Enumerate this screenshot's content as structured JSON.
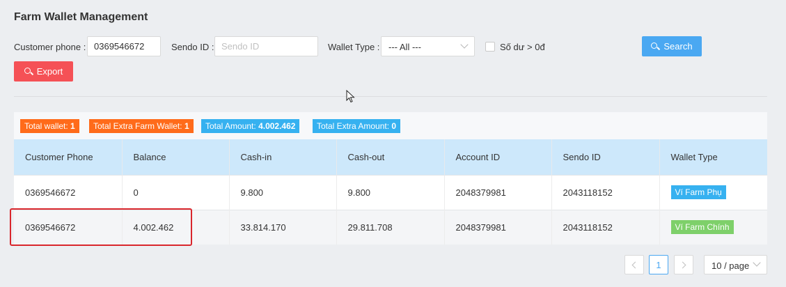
{
  "page": {
    "title": "Farm Wallet Management"
  },
  "filters": {
    "customer_phone_label": "Customer phone :",
    "customer_phone_value": "0369546672",
    "sendo_id_label": "Sendo ID :",
    "sendo_id_placeholder": "Sendo ID",
    "wallet_type_label": "Wallet Type :",
    "wallet_type_value": "--- All ---",
    "balance_checkbox_label": "Số dư > 0đ",
    "balance_checkbox_checked": false,
    "search_label": "Search",
    "export_label": "Export"
  },
  "summary": {
    "total_wallet_label": "Total wallet:",
    "total_wallet_value": "1",
    "total_extra_label": "Total Extra Farm Wallet:",
    "total_extra_value": "1",
    "total_amount_label": "Total Amount:",
    "total_amount_value": "4.002.462",
    "total_extra_amount_label": "Total Extra Amount:",
    "total_extra_amount_value": "0"
  },
  "table": {
    "columns": [
      "Customer Phone",
      "Balance",
      "Cash-in",
      "Cash-out",
      "Account ID",
      "Sendo ID",
      "Wallet Type"
    ],
    "rows": [
      {
        "phone": "0369546672",
        "balance": "0",
        "cash_in": "9.800",
        "cash_out": "9.800",
        "account_id": "2048379981",
        "sendo_id": "2043118152",
        "wallet_type": "Ví Farm Phụ"
      },
      {
        "phone": "0369546672",
        "balance": "4.002.462",
        "cash_in": "33.814.170",
        "cash_out": "29.811.708",
        "account_id": "2048379981",
        "sendo_id": "2043118152",
        "wallet_type": "Ví Farm Chính"
      }
    ]
  },
  "pagination": {
    "current_page": "1",
    "page_size": "10 / page"
  },
  "colors": {
    "primary_blue": "#4aa8f2",
    "export_red": "#f55156",
    "tag_orange": "#ff6b1a",
    "tag_blue": "#36b1f0",
    "tag_green": "#7ed06a",
    "highlight_red": "#d9262c"
  }
}
